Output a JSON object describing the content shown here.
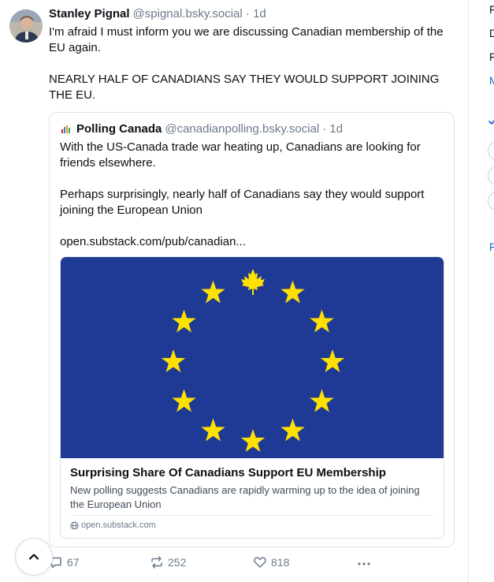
{
  "post": {
    "author_name": "Stanley Pignal",
    "author_handle": "@spignal.bsky.social",
    "time": "· 1d",
    "paragraphs": [
      "I'm afraid I must inform you we are discussing Canadian membership of the EU again.",
      "NEARLY HALF OF CANADIANS SAY THEY WOULD SUPPORT JOINING THE EU."
    ]
  },
  "quote": {
    "author_name": "Polling Canada",
    "author_handle": "@canadianpolling.bsky.social",
    "time": "· 1d",
    "paragraphs": [
      "With the US-Canada trade war heating up, Canadians are looking for friends elsewhere.",
      "Perhaps surprisingly, nearly half of Canadians say they would support joining the European Union",
      "open.substack.com/pub/canadian..."
    ]
  },
  "link_card": {
    "title": "Surprising Share Of Canadians Support EU Membership",
    "description": "New polling suggests Canadians are rapidly warming up to the idea of joining the European Union",
    "domain": "open.substack.com",
    "flag_color": "#1f3a94",
    "star_color": "#ffe100"
  },
  "actions": {
    "replies": "67",
    "reposts": "252",
    "likes": "818"
  },
  "right_rail": {
    "letters": [
      "F",
      "D",
      "F",
      "M"
    ],
    "bottom_letter": "F"
  },
  "colors": {
    "muted": "#6b7a8b",
    "link": "#1666d7",
    "border": "#dfe3e8"
  }
}
